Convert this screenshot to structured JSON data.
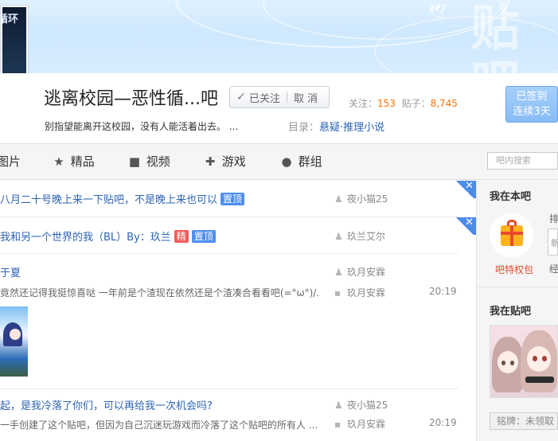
{
  "forum": {
    "avatar_text": "循环",
    "title": "逃离校园—恶性循...吧",
    "follow_label": "已关注",
    "unfollow_label": "取 消",
    "stats_follow_label": "关注：",
    "stats_follow_value": "153",
    "stats_posts_label": "贴子：",
    "stats_posts_value": "8,745",
    "signin_line1": "已签到",
    "signin_line2": "连续3天",
    "slogan": "别指望能离开这校园，没有人能活着出去。 ...",
    "catalog_label": "目录：",
    "catalog_value": "悬疑·推理小说"
  },
  "nav": {
    "tabs": [
      {
        "label": "图片",
        "icon": "picture-icon"
      },
      {
        "label": "精品",
        "icon": "star-icon"
      },
      {
        "label": "视频",
        "icon": "video-icon"
      },
      {
        "label": "游戏",
        "icon": "gamepad-icon"
      },
      {
        "label": "群组",
        "icon": "chat-icon"
      }
    ],
    "search_placeholder": "吧内搜索"
  },
  "threads": [
    {
      "title": "八月二十号晚上来一下贴吧，不是晚上来也可以",
      "badges": [
        "置顶"
      ],
      "author": "夜小猫25"
    },
    {
      "title": "我和另一个世界的我（BL）By：玖兰",
      "badges": [
        "精",
        "置顶"
      ],
      "author": "玖兰艾尔"
    },
    {
      "title": "于夏",
      "excerpt": "竟然还记得我挺惊喜哒 一年前是个渣现在依然还是个渣凑合看看吧(=°ω°)/...",
      "author": "玖月安霖",
      "reply_author": "玖月安霖",
      "time": "20:19"
    },
    {
      "title": "起，是我冷落了你们，可以再给我一次机会吗?",
      "excerpt": "一手创建了这个贴吧，但因为自己沉迷玩游戏而冷落了这个贴吧的所有人 ...",
      "author": "夜小猫25",
      "reply_author": "玖月安霖",
      "time": "20:19"
    }
  ],
  "sidebar": {
    "my_forum_title": "我在本吧",
    "privilege_label": "吧特权包",
    "cut_label_1": "排",
    "cut_label_2": "经",
    "my_post_title": "我在贴吧",
    "nameplate": "铭牌：未领取"
  },
  "colors": {
    "link": "#2d64b3",
    "top_badge": "#4e8ef0",
    "jing_badge": "#f25a5a",
    "count": "#ff7200"
  }
}
